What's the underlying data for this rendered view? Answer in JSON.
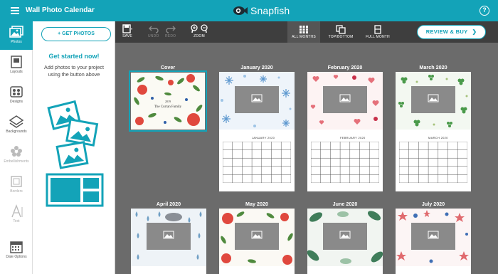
{
  "app": {
    "title": "Wall Photo Calendar",
    "brand": "Snapfish",
    "help": "?",
    "accent_color": "#13a3b8"
  },
  "rail": {
    "items": [
      {
        "label": "Photos",
        "icon": "photos-icon",
        "active": true
      },
      {
        "label": "Layouts",
        "icon": "layouts-icon"
      },
      {
        "label": "Designs",
        "icon": "designs-icon"
      },
      {
        "label": "Backgrounds",
        "icon": "backgrounds-icon"
      },
      {
        "label": "Embellishments",
        "icon": "embellishments-icon",
        "disabled": true
      },
      {
        "label": "Borders",
        "icon": "borders-icon",
        "disabled": true
      },
      {
        "label": "Text",
        "icon": "text-icon",
        "disabled": true
      },
      {
        "label": "Date Options",
        "icon": "calendar-icon"
      }
    ]
  },
  "panel": {
    "get_photos_label": "+ GET PHOTOS",
    "heading": "Get started now!",
    "description": "Add photos to your project using the button above"
  },
  "toolbar": {
    "save": "SAVE",
    "undo": "UNDO",
    "redo": "REDO",
    "zoom": "ZOOM",
    "views": [
      "ALL MONTHS",
      "TOP/BOTTOM",
      "FULL MONTH"
    ],
    "active_view": "ALL MONTHS",
    "review_buy": "REVIEW & BUY"
  },
  "pages": [
    {
      "title": "Cover",
      "theme": "botanical",
      "cover_text": "2019\nThe Curran Family",
      "selected": true
    },
    {
      "title": "January 2020",
      "month_label": "JANUARY 2020",
      "theme": "snowflakes"
    },
    {
      "title": "February 2020",
      "month_label": "FEBRUARY 2020",
      "theme": "hearts"
    },
    {
      "title": "March 2020",
      "month_label": "MARCH 2020",
      "theme": "clovers"
    },
    {
      "title": "April 2020",
      "theme": "raindrops"
    },
    {
      "title": "May 2020",
      "theme": "poppies"
    },
    {
      "title": "June 2020",
      "theme": "leaves"
    },
    {
      "title": "July 2020",
      "theme": "stars"
    }
  ]
}
